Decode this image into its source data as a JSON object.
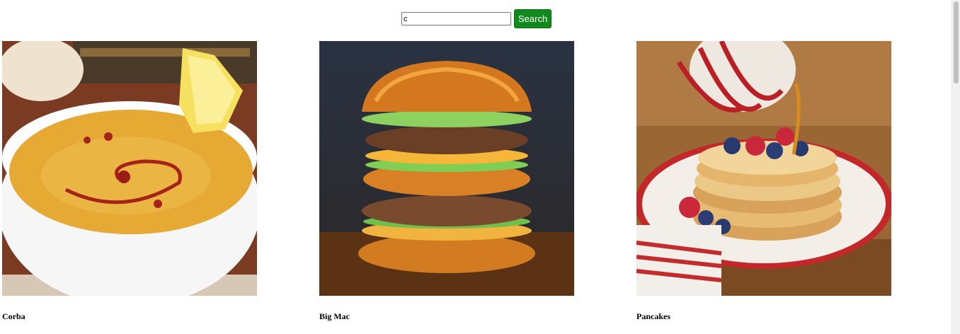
{
  "search": {
    "value": "c",
    "button_label": "Search"
  },
  "recipes": [
    {
      "title": "Corba",
      "image_icon": "lentil-soup-image"
    },
    {
      "title": "Big Mac",
      "image_icon": "burger-image"
    },
    {
      "title": "Pancakes",
      "image_icon": "pancakes-image"
    }
  ],
  "colors": {
    "search_button": "#118a1d",
    "background": "#ffffff"
  }
}
